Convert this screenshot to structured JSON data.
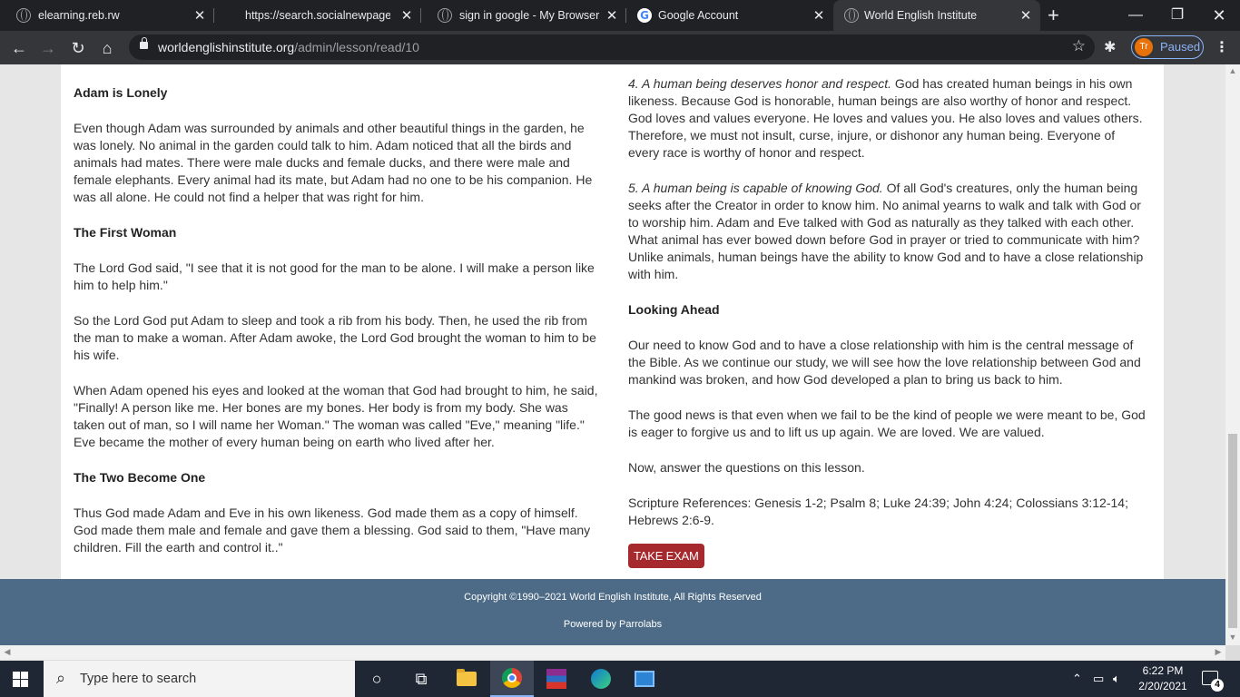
{
  "browser": {
    "tabs": [
      {
        "title": "elearning.reb.rw",
        "icon": "globe-icon"
      },
      {
        "title": "https://search.socialnewpages.com",
        "icon": "none"
      },
      {
        "title": "sign in google - My Browser Search",
        "icon": "globe-icon"
      },
      {
        "title": "Google Account",
        "icon": "google-icon"
      },
      {
        "title": "World English Institute",
        "icon": "globe-icon"
      }
    ],
    "url_domain": "worldenglishinstitute.org",
    "url_path": "/admin/lesson/read/10",
    "profile_initials": "Tr",
    "profile_status": "Paused",
    "accent": "#8ab4f8"
  },
  "lesson": {
    "left": {
      "h_adam": "Adam is Lonely",
      "p_adam": "Even though Adam was surrounded by animals and other beautiful things in the garden, he was lonely. No animal in the garden could talk to him. Adam noticed that all the birds and animals had mates. There were male ducks and female ducks, and there were male and female elephants. Every animal had its mate, but Adam had no one to be his companion. He was all alone. He could not find a helper that was right for him.",
      "h_woman": "The First Woman",
      "p_woman1": "The Lord God said, \"I see that it is not good for the man to be alone. I will make a person like him to help him.\"",
      "p_woman2": "So the Lord God put Adam to sleep and took a rib from his body. Then, he used the rib from the man to make a woman. After Adam awoke, the Lord God brought the woman to him to be his wife.",
      "p_woman3": "When Adam opened his eyes and looked at the woman that God had brought to him, he said, \"Finally! A person like me. Her bones are my bones. Her body is from my body. She was taken out of man, so I will name her Woman.\" The woman was called \"Eve,\" meaning \"life.\" Eve became the mother of every human being on earth who lived after her.",
      "h_two": "The Two Become One",
      "p_two": "Thus God made Adam and Eve in his own likeness. God made them as a copy of himself. God made them male and female and gave them a blessing. God said to them, \"Have many children. Fill the earth and control it..\""
    },
    "right": {
      "p4_lead": "4. A human being deserves honor and respect.",
      "p4_body": " God has created human beings in his own likeness. Because God is honorable, human beings are also worthy of honor and respect. God loves and values everyone. He loves and values you. He also loves and values others. Therefore, we must not insult, curse, injure, or dishonor any human being. Everyone of every race is worthy of honor and respect.",
      "p5_lead": "5. A human being is capable of knowing God.",
      "p5_body": " Of all God's creatures, only the human being seeks after the Creator in order to know him. No animal yearns to walk and talk with God or to worship him. Adam and Eve talked with God as naturally as they talked with each other. What animal has ever bowed down before God in prayer or tried to communicate with him? Unlike animals, human beings have the ability to know God and to have a close relationship with him.",
      "h_ahead": "Looking Ahead",
      "p_ahead1": "Our need to know God and to have a close relationship with him is the central message of the Bible. As we continue our study, we will see how the love relationship between God and mankind was broken, and how God developed a plan to bring us back to him.",
      "p_ahead2": "The good news is that even when we fail to be the kind of people we were meant to be, God is eager to forgive us and to lift us up again. We are loved. We are valued.",
      "p_answer": "Now, answer the questions on this lesson.",
      "p_refs": "Scripture References: Genesis 1-2; Psalm 8; Luke 24:39; John 4:24; Colossians 3:12-14; Hebrews 2:6-9.",
      "exam_button": "TAKE EXAM"
    }
  },
  "footer": {
    "copyright": "Copyright ©1990–2021 World English Institute, All Rights Reserved",
    "powered": "Powered by Parrolabs",
    "color": "#4d6b86"
  },
  "taskbar": {
    "search_placeholder": "Type here to search",
    "time": "6:22 PM",
    "date": "2/20/2021",
    "notification_count": "4"
  }
}
